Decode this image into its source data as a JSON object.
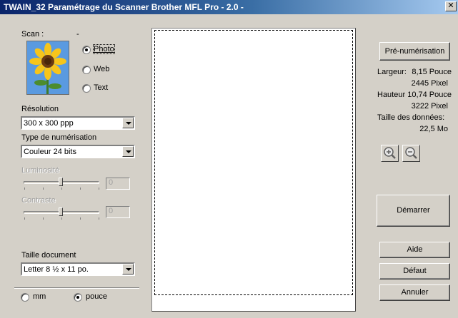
{
  "window": {
    "title": "TWAIN_32 Paramétrage du Scanner Brother MFL Pro - 2.0 -",
    "close_glyph": "✕"
  },
  "scan": {
    "label": "Scan :",
    "dash": "-",
    "options": [
      {
        "label": "Photo",
        "checked": true
      },
      {
        "label": "Web",
        "checked": false
      },
      {
        "label": "Text",
        "checked": false
      }
    ]
  },
  "resolution": {
    "label": "Résolution",
    "value": "300 x 300 ppp"
  },
  "scan_type": {
    "label": "Type de numérisation",
    "value": "Couleur 24 bits"
  },
  "brightness": {
    "label": "Luminosité",
    "value": "0"
  },
  "contrast": {
    "label": "Contraste",
    "value": "0"
  },
  "document_size": {
    "label": "Taille document",
    "value": "Letter 8 ½ x 11 po."
  },
  "units": {
    "options": [
      {
        "label": "mm",
        "checked": false
      },
      {
        "label": "pouce",
        "checked": true
      }
    ]
  },
  "prescan_button": "Pré-numérisation",
  "info": {
    "width_label": "Largeur:",
    "width_inch": "8,15 Pouce",
    "width_px": "2445 Pixel",
    "height_label": "Hauteur",
    "height_inch": "10,74 Pouce",
    "height_px": "3222 Pixel",
    "data_size_label": "Taille des données:",
    "data_size_value": "22,5 Mo"
  },
  "buttons": {
    "start": "Démarrer",
    "help": "Aide",
    "default": "Défaut",
    "cancel": "Annuler"
  },
  "icons": [
    "zoom-in-icon",
    "zoom-out-icon",
    "sunflower-thumbnail"
  ]
}
